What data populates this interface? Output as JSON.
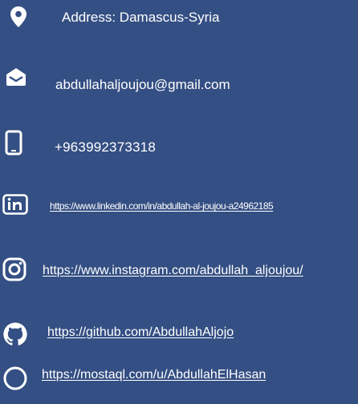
{
  "contact": {
    "address": {
      "text": "Address: Damascus-Syria",
      "icon": "map-pin-icon"
    },
    "email": {
      "text": "abdullahaljoujou@gmail.com",
      "icon": "envelope-icon"
    },
    "phone": {
      "text": "+963992373318",
      "icon": "mobile-phone-icon"
    },
    "linkedin": {
      "text": "https://www.linkedin.com/in/abdullah-al-joujou-a24962185",
      "icon": "linkedin-icon"
    },
    "instagram": {
      "text": "https://www.instagram.com/abdullah_aljoujou/",
      "icon": "instagram-icon"
    },
    "github": {
      "text": "https://github.com/AbdullahAljojo",
      "icon": "github-icon"
    },
    "mostaql": {
      "text": "https://mostaql.com/u/AbdullahElHasan",
      "icon": "circle-icon"
    }
  },
  "colors": {
    "background": "#344f83",
    "text": "#ffffff"
  }
}
